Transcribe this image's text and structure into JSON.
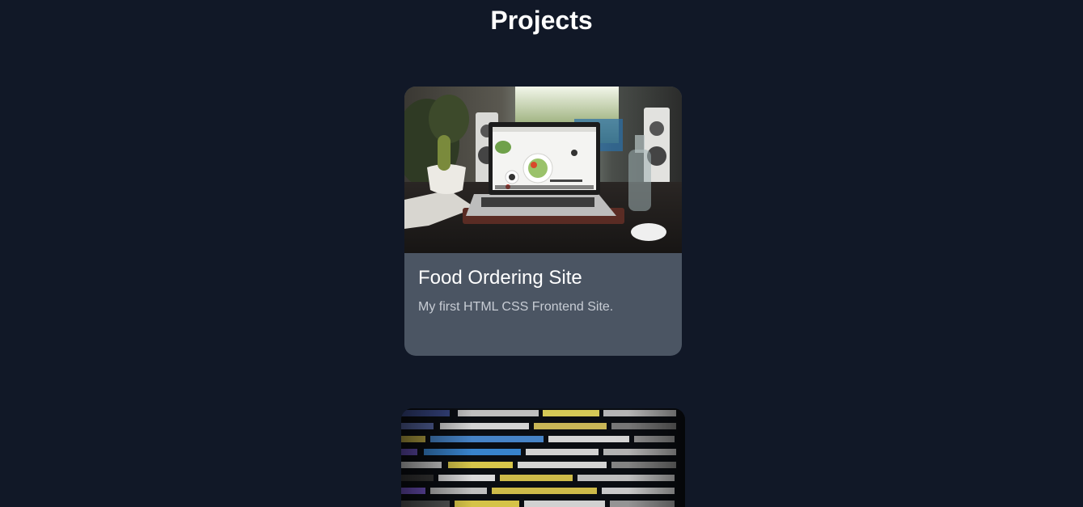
{
  "page": {
    "title": "Projects"
  },
  "projects": [
    {
      "title": "Food Ordering Site",
      "description": "My first HTML CSS Frontend Site.",
      "image": "laptop-on-desk-photo"
    },
    {
      "title": "",
      "description": "",
      "image": "code-on-screen-photo"
    }
  ],
  "colors": {
    "background": "#111827",
    "card": "#4b5563",
    "title": "#ffffff",
    "description": "#c7ccd4"
  }
}
